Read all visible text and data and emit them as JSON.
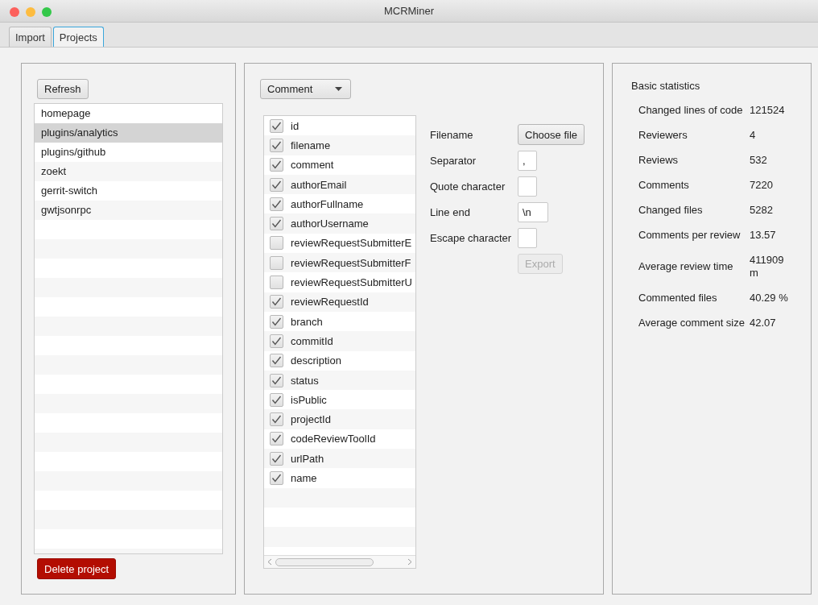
{
  "window": {
    "title": "MCRMiner"
  },
  "tabs": [
    {
      "label": "Import",
      "selected": false
    },
    {
      "label": "Projects",
      "selected": true
    }
  ],
  "projects": {
    "refresh_button": "Refresh",
    "items": [
      {
        "label": "homepage",
        "selected": false
      },
      {
        "label": "plugins/analytics",
        "selected": true
      },
      {
        "label": "plugins/github",
        "selected": false
      },
      {
        "label": "zoekt",
        "selected": false
      },
      {
        "label": "gerrit-switch",
        "selected": false
      },
      {
        "label": "gwtjsonrpc",
        "selected": false
      }
    ],
    "delete_button": "Delete project"
  },
  "export": {
    "type_dropdown": "Comment",
    "fields": [
      {
        "label": "id",
        "checked": true
      },
      {
        "label": "filename",
        "checked": true
      },
      {
        "label": "comment",
        "checked": true
      },
      {
        "label": "authorEmail",
        "checked": true
      },
      {
        "label": "authorFullname",
        "checked": true
      },
      {
        "label": "authorUsername",
        "checked": true
      },
      {
        "label": "reviewRequestSubmitterE",
        "checked": false
      },
      {
        "label": "reviewRequestSubmitterF",
        "checked": false
      },
      {
        "label": "reviewRequestSubmitterU",
        "checked": false
      },
      {
        "label": "reviewRequestId",
        "checked": true
      },
      {
        "label": "branch",
        "checked": true
      },
      {
        "label": "commitId",
        "checked": true
      },
      {
        "label": "description",
        "checked": true
      },
      {
        "label": "status",
        "checked": true
      },
      {
        "label": "isPublic",
        "checked": true
      },
      {
        "label": "projectId",
        "checked": true
      },
      {
        "label": "codeReviewToolId",
        "checked": true
      },
      {
        "label": "urlPath",
        "checked": true
      },
      {
        "label": "name",
        "checked": true
      }
    ],
    "options": [
      {
        "kind": "button",
        "label": "Filename",
        "button": "Choose file"
      },
      {
        "kind": "field",
        "label": "Separator",
        "value": ","
      },
      {
        "kind": "field",
        "label": "Quote character"
      },
      {
        "kind": "field",
        "label": "Line end",
        "value": "\\n"
      },
      {
        "kind": "field",
        "label": "Escape character"
      }
    ],
    "export_button": {
      "label": "Export",
      "disabled": true
    }
  },
  "statistics": {
    "title": "Basic statistics",
    "rows": [
      {
        "label": "Changed lines of code",
        "value": "121524"
      },
      {
        "label": "Reviewers",
        "value": "4"
      },
      {
        "label": "Reviews",
        "value": "532"
      },
      {
        "label": "Comments",
        "value": "7220"
      },
      {
        "label": "Changed files",
        "value": "5282"
      },
      {
        "label": "Comments per review",
        "value": "13.57"
      },
      {
        "label": "Average review time",
        "value": "411909 m"
      },
      {
        "label": "Commented files",
        "value": "40.29 %"
      },
      {
        "label": "Average comment size",
        "value": "42.07"
      }
    ]
  }
}
